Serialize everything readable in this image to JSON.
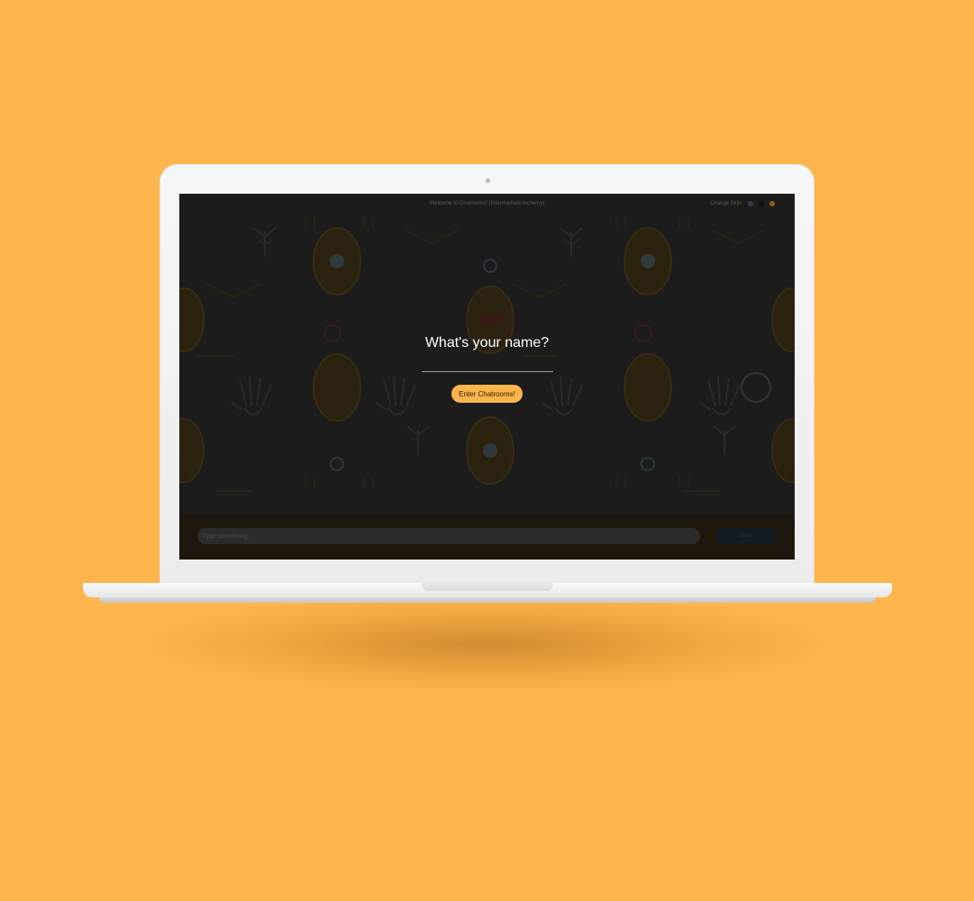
{
  "header": {
    "welcome_text": "Welcome to Chatrooms! (Intermediate Alchemy)",
    "change_skin_label": "Change Skin:"
  },
  "skins": [
    {
      "name": "purple",
      "color": "#3d3650"
    },
    {
      "name": "black",
      "color": "#0d0d0d"
    },
    {
      "name": "orange",
      "color": "#8a5a14"
    }
  ],
  "login": {
    "question": "What's your name?",
    "name_value": "",
    "enter_button": "Enter Chatrooms!"
  },
  "composer": {
    "placeholder": "Type something...",
    "send_button": "Send"
  },
  "colors": {
    "background": "#FDB54C",
    "accent": "#FDB54C",
    "overlay": "#1c1c1c"
  }
}
